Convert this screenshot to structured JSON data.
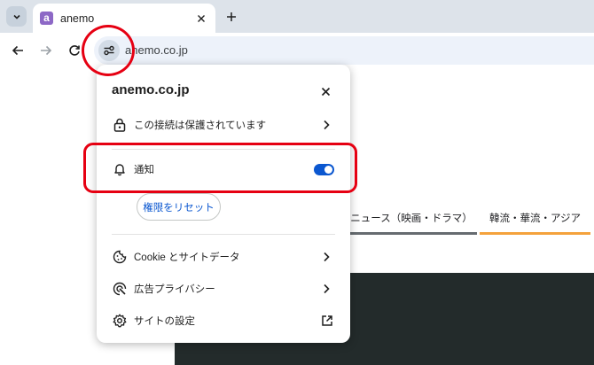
{
  "browser": {
    "tab": {
      "title": "anemo",
      "favicon_letter": "a",
      "favicon_color": "#8d68c6"
    },
    "omnibox": {
      "url": "anemo.co.jp"
    }
  },
  "page": {
    "category_tabs": [
      {
        "label": "ニュース（映画・ドラマ）",
        "underline_color": "#666b70"
      },
      {
        "label": "韓流・華流・アジア",
        "underline_color": "#f4a23c"
      }
    ]
  },
  "popup": {
    "title": "anemo.co.jp",
    "connection": {
      "label": "この接続は保護されています",
      "icon": "lock-icon"
    },
    "notifications": {
      "label": "通知",
      "icon": "bell-icon",
      "enabled": true
    },
    "reset_label": "権限をリセット",
    "cookies": {
      "label": "Cookie とサイトデータ",
      "icon": "cookie-icon"
    },
    "ad_privacy": {
      "label": "広告プライバシー",
      "icon": "ad-privacy-icon"
    },
    "site_settings": {
      "label": "サイトの設定",
      "icon": "gear-icon"
    }
  },
  "annotation_color": "#e60012",
  "accent_color": "#0b57d0"
}
